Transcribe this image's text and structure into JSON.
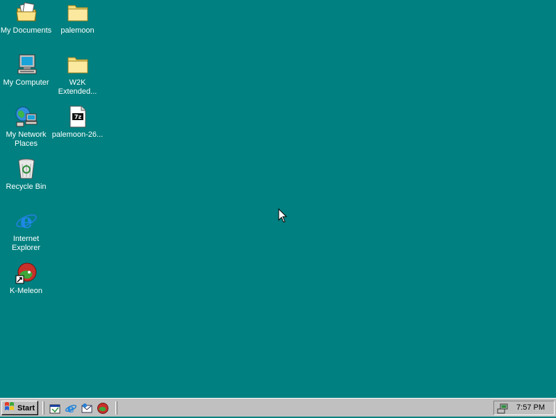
{
  "desktop": {
    "background_color": "#008080",
    "icons": [
      {
        "label": "My Documents",
        "icon": "my-documents-icon"
      },
      {
        "label": "palemoon",
        "icon": "folder-icon"
      },
      {
        "label": "My Computer",
        "icon": "my-computer-icon"
      },
      {
        "label": "W2K",
        "label2": "Extended...",
        "icon": "folder-icon"
      },
      {
        "label": "My Network",
        "label2": "Places",
        "icon": "network-places-icon"
      },
      {
        "label": "palemoon-26...",
        "icon": "7z-archive-icon"
      },
      {
        "label": "Recycle Bin",
        "icon": "recycle-bin-icon"
      },
      {
        "label": "Internet",
        "label2": "Explorer",
        "icon": "internet-explorer-icon"
      },
      {
        "label": "K-Meleon",
        "icon": "k-meleon-icon"
      }
    ]
  },
  "taskbar": {
    "start_label": "Start",
    "quick_launch": [
      "show-desktop-icon",
      "internet-explorer-icon",
      "outlook-express-icon",
      "k-meleon-icon"
    ],
    "tray_icon": "network-connection-icon",
    "clock": "7:57 PM"
  }
}
